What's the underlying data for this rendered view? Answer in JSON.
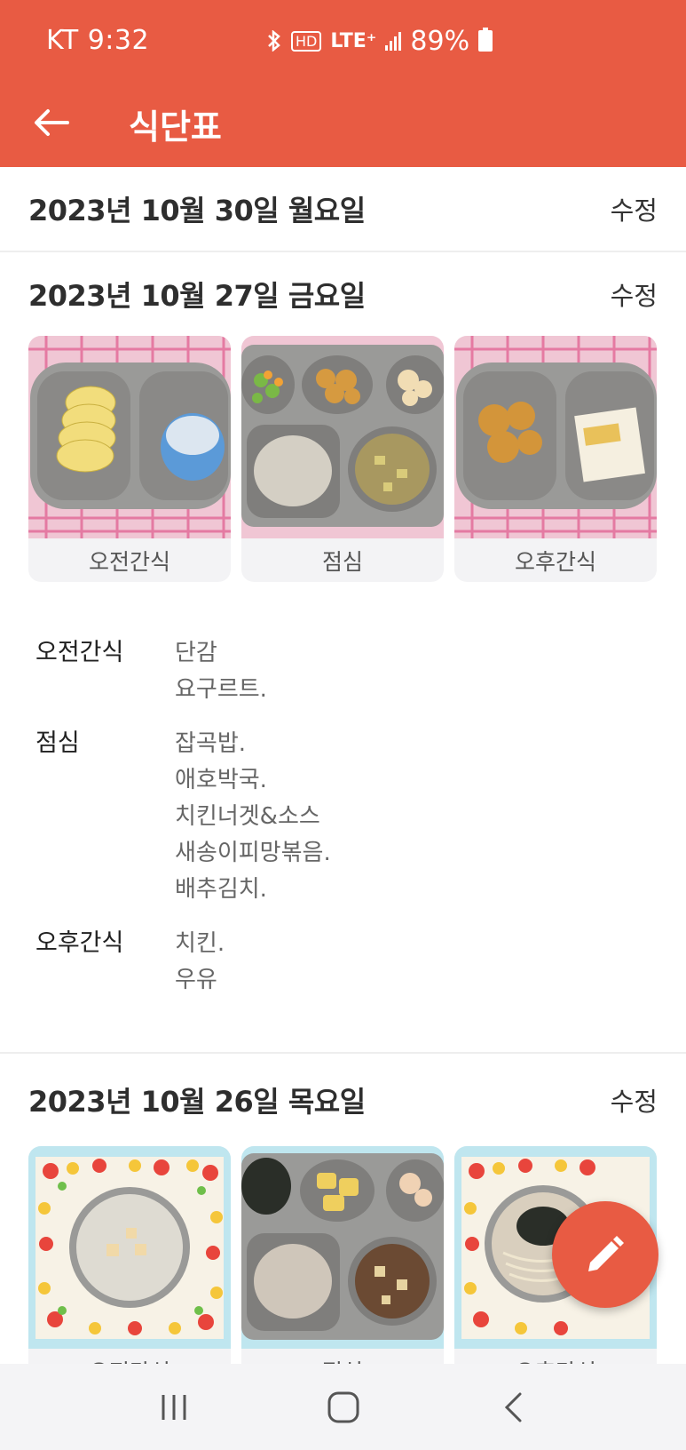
{
  "status_bar": {
    "carrier_time": "KT 9:32",
    "network": "LTE⁺",
    "hd": "HD",
    "battery": "89%"
  },
  "toolbar": {
    "title": "식단표"
  },
  "days": [
    {
      "date": "2023년 10월 30일 월요일",
      "edit": "수정"
    },
    {
      "date": "2023년 10월 27일 금요일",
      "edit": "수정",
      "photos": [
        "오전간식",
        "점심",
        "오후간식"
      ],
      "menu": [
        {
          "label": "오전간식",
          "items": [
            "단감",
            "요구르트."
          ]
        },
        {
          "label": "점심",
          "items": [
            "잡곡밥.",
            "애호박국.",
            "치킨너겟&소스",
            "새송이피망볶음.",
            "배추김치."
          ]
        },
        {
          "label": "오후간식",
          "items": [
            "치킨.",
            "우유"
          ]
        }
      ]
    },
    {
      "date": "2023년 10월 26일 목요일",
      "edit": "수정",
      "photos": [
        "오전간식",
        "점심",
        "오후간식"
      ]
    }
  ],
  "colors": {
    "accent": "#E85B43",
    "background": "#FFFFFF"
  },
  "icons": {
    "back": "arrow-left-icon",
    "fab": "pencil-icon",
    "nav": [
      "recent-apps-icon",
      "home-icon",
      "back-nav-icon"
    ]
  }
}
